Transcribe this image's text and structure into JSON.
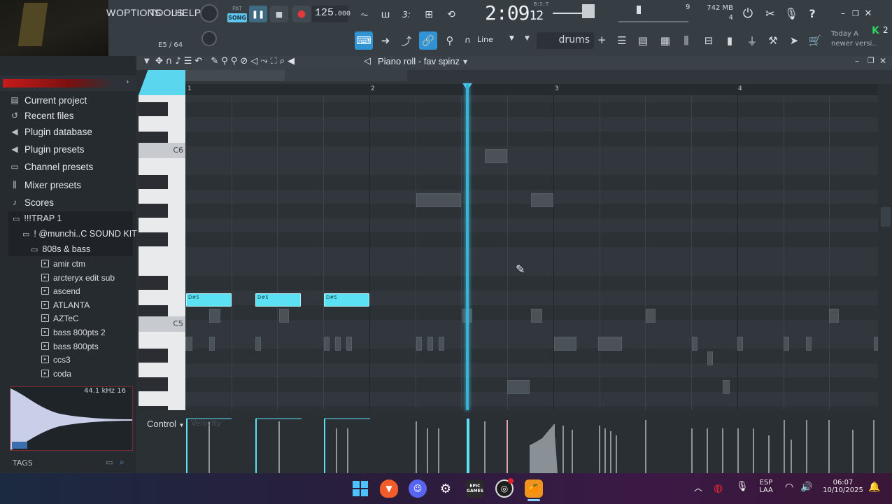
{
  "menu": {
    "items": [
      "W",
      "OPTIONS",
      "TOOLS",
      "HELP"
    ]
  },
  "transport": {
    "pat_label": "PAT",
    "song_label": "SONG",
    "tempo": "125",
    "tempo_decimals": ".000",
    "time_main": "2:09",
    "time_ms": "12",
    "time_sub": "B:S:T"
  },
  "status": {
    "memory": "742 MB",
    "cpu": "9",
    "voices": "4",
    "note_position": "E5 / 64"
  },
  "hint": {
    "line1": "Today  A",
    "line2": "newer versi.."
  },
  "notify_badge": "2",
  "toolbar": {
    "snap_label": "Line",
    "pattern_name": "drums",
    "add_label": "+"
  },
  "piano_roll": {
    "title": "Piano roll - fav spinz",
    "ruler_numbers": [
      "1",
      "2",
      "3",
      "4"
    ],
    "octave_labels": [
      "C6",
      "C5"
    ],
    "note_label": "D#5",
    "control_label": "Control",
    "control_target": "Velocity"
  },
  "browser": {
    "nav": [
      {
        "label": "Current project",
        "icon": "project-icon"
      },
      {
        "label": "Recent files",
        "icon": "recent-icon"
      },
      {
        "label": "Plugin database",
        "icon": "plugin-db-icon"
      },
      {
        "label": "Plugin presets",
        "icon": "plugin-preset-icon"
      },
      {
        "label": "Channel presets",
        "icon": "channel-preset-icon"
      },
      {
        "label": "Mixer presets",
        "icon": "mixer-preset-icon"
      },
      {
        "label": "Scores",
        "icon": "note-icon"
      }
    ],
    "folders": [
      "!!!TRAP 1",
      "! @munchi..C SOUND KIT",
      "808s & bass"
    ],
    "files": [
      "amir ctm",
      "arcteryx edit sub",
      "ascend",
      "ATLANTA",
      "AZTeC",
      "bass 800pts 2",
      "bass 800pts",
      "ccs3",
      "coda"
    ],
    "sample_rate": "44.1 kHz",
    "bit_depth": "16",
    "tags_label": "TAGS"
  },
  "taskbar": {
    "language": "ESP",
    "layout": "LAA",
    "time": "06:07",
    "date": "10/10/2025",
    "apps": [
      "start",
      "brave",
      "discord",
      "steam",
      "epic-games",
      "obs",
      "fl-studio"
    ],
    "epic_label": "EPIC GAMES"
  }
}
